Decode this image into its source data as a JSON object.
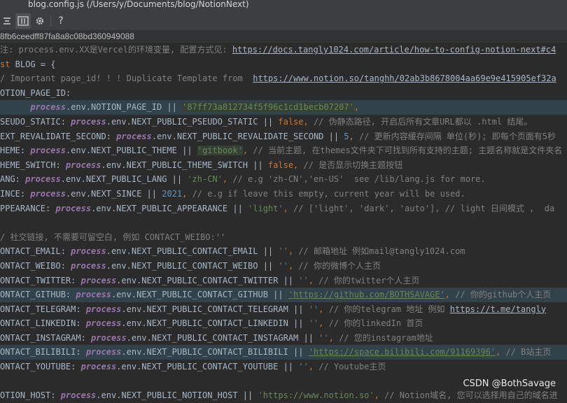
{
  "window": {
    "title": "blog.config.js (/Users/y/Documents/blog/NotionNext)"
  },
  "toolbar": {
    "btn1_icon": "align-icon",
    "btn2_icon": "columns-icon",
    "btn3_icon": "gear-icon",
    "help_label": "?"
  },
  "commit_hash": "8fb6ceedff87fa8a8c08bd360949088",
  "code": {
    "l1": {
      "a": "注: process.env.XX是Vercel的环境变量, 配置方式见: ",
      "url": "https://docs.tangly1024.com/article/how-to-config-notion-next#c4"
    },
    "l2": {
      "kw": "st",
      "rest": " BLOG = {"
    },
    "l3": {
      "c1": "/ Important page_id! ! ! Duplicate Template from  ",
      "url": "https://www.notion.so/tanghh/02ab3b8678004aa69e9e415905ef32a"
    },
    "l4": {
      "key": "OTION_PAGE_ID:"
    },
    "l5": {
      "indent": "      ",
      "p": "process",
      "mid": ".env.NOTION_PAGE_ID || ",
      "s": "'87ff73a812734f5f96c1cd1becb07207'",
      "end": ","
    },
    "l6": {
      "key": "SEUDO_STATIC: ",
      "p": "process",
      "mid": ".env.NEXT_PUBLIC_PSEUDO_STATIC || ",
      "k": "false",
      "end": ", ",
      "c": "// 伪静态路径, 开启后所有文章URL都以 .html 结尾。"
    },
    "l7": {
      "key": "EXT_REVALIDATE_SECOND: ",
      "p": "process",
      "mid": ".env.NEXT_PUBLIC_REVALIDATE_SECOND || ",
      "n": "5",
      "end": ", ",
      "c": "// 更新内容缓存间隔 单位(秒); 即每个页面有5秒"
    },
    "l8": {
      "key": "HEME: ",
      "p": "process",
      "mid": ".env.NEXT_PUBLIC_THEME || ",
      "s": "'gitbook'",
      "end": ", ",
      "c": "// 当前主题, 在themes文件夹下可找到所有支持的主题; 主题名称就是文件夹名"
    },
    "l9": {
      "key": "HEME_SWITCH: ",
      "p": "process",
      "mid": ".env.NEXT_PUBLIC_THEME_SWITCH || ",
      "k": "false",
      "end": ", ",
      "c": "// 是否显示切换主题按钮"
    },
    "l10": {
      "key": "ANG: ",
      "p": "process",
      "mid": ".env.NEXT_PUBLIC_LANG || ",
      "s": "'zh-CN'",
      "end": ", ",
      "c": "// e.g 'zh-CN','en-US'  see /lib/lang.js for more."
    },
    "l11": {
      "key": "INCE: ",
      "p": "process",
      "mid": ".env.NEXT_SINCE || ",
      "n": "2021",
      "end": ", ",
      "c": "// e.g if leave this empty, current year will be used."
    },
    "l12": {
      "key": "PPEARANCE: ",
      "p": "process",
      "mid": ".env.NEXT_PUBLIC_APPEARANCE || ",
      "s": "'light'",
      "end": ", ",
      "c": "// ['light', 'dark', 'auto'], // light 日间模式 ,  da"
    },
    "l13": {
      "c": "/ 社交链接, 不需要可留空白, 例如 CONTACT_WEIBO:''"
    },
    "l14": {
      "key": "ONTACT_EMAIL: ",
      "p": "process",
      "mid": ".env.NEXT_PUBLIC_CONTACT_EMAIL || ",
      "s": "''",
      "end": ", ",
      "c": "// 邮箱地址 例如mail@tangly1024.com"
    },
    "l15": {
      "key": "ONTACT_WEIBO: ",
      "p": "process",
      "mid": ".env.NEXT_PUBLIC_CONTACT_WEIBO || ",
      "s": "''",
      "end": ", ",
      "c": "// 你的微博个人主页"
    },
    "l16": {
      "key": "ONTACT_TWITTER: ",
      "p": "process",
      "mid": ".env.NEXT_PUBLIC_CONTACT_TWITTER || ",
      "s": "''",
      "end": ", ",
      "c": "// 你的twitter个人主页"
    },
    "l17": {
      "key": "ONTACT_GITHUB: ",
      "p": "process",
      "mid": ".env.NEXT_PUBLIC_CONTACT_GITHUB || ",
      "s": "'https://github.com/BOTHSAVAGE'",
      "end": ", ",
      "c": "// 你的github个人主页"
    },
    "l18": {
      "key": "ONTACT_TELEGRAM: ",
      "p": "process",
      "mid": ".env.NEXT_PUBLIC_CONTACT_TELEGRAM || ",
      "s": "''",
      "end": ", ",
      "c": "// 你的telegram 地址 例如 ",
      "url": "https://t.me/tangly"
    },
    "l19": {
      "key": "ONTACT_LINKEDIN: ",
      "p": "process",
      "mid": ".env.NEXT_PUBLIC_CONTACT_LINKEDIN || ",
      "s": "''",
      "end": ", ",
      "c": "// 你的linkedIn 首页"
    },
    "l20": {
      "key": "ONTACT_INSTAGRAM: ",
      "p": "process",
      "mid": ".env.NEXT_PUBLIC_CONTACT_INSTAGRAM || ",
      "s": "''",
      "end": ", ",
      "c": "// 您的instagram地址"
    },
    "l21": {
      "key": "ONTACT_BILIBILI: ",
      "p": "process",
      "mid": ".env.NEXT_PUBLIC_CONTACT_BILIBILI || ",
      "s": "'https://space.bilibili.com/91169396'",
      "end": ", ",
      "c": "// B站主页"
    },
    "l22": {
      "key": "ONTACT_YOUTUBE: ",
      "p": "process",
      "mid": ".env.NEXT_PUBLIC_CONTACT_YOUTUBE || ",
      "s": "''",
      "end": ", ",
      "c": "// Youtube主页"
    },
    "l23": {
      "key": "OTION_HOST: ",
      "p": "process",
      "mid": ".env.NEXT_PUBLIC_NOTION_HOST || ",
      "s": "'https://www.notion.so'",
      "end": ", ",
      "c": "// Notion域名, 您可以选择用自己的域名进"
    }
  },
  "watermark": "CSDN @BothSavage"
}
